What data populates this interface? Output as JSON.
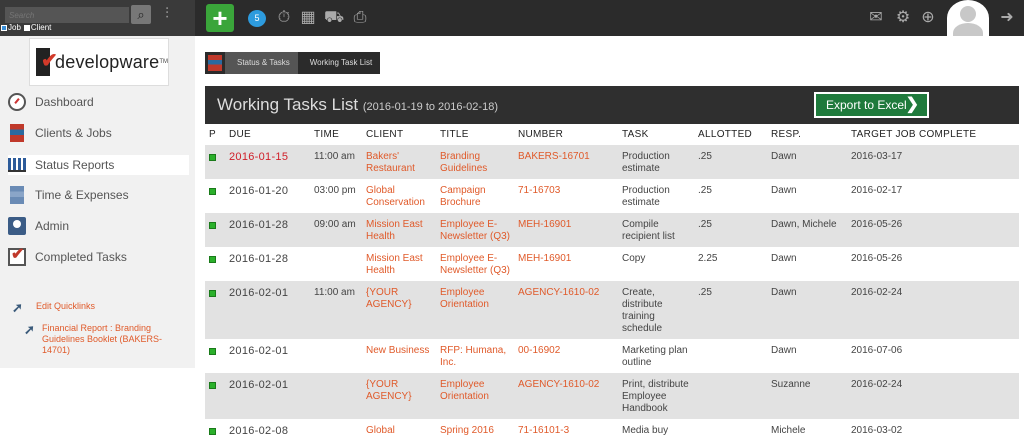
{
  "search": {
    "placeholder": "Search",
    "options": [
      {
        "label": "Job",
        "checked": true
      },
      {
        "label": "Client",
        "checked": false
      }
    ]
  },
  "topbar": {
    "chat_count": "5"
  },
  "logo": {
    "text": "developware",
    "tm": "TM"
  },
  "sidebar": {
    "items": [
      {
        "label": "Dashboard",
        "icon": "dashboard-icon"
      },
      {
        "label": "Clients & Jobs",
        "icon": "clients-jobs-icon"
      },
      {
        "label": "Status Reports",
        "icon": "bar-chart-icon",
        "active": true
      },
      {
        "label": "Time & Expenses",
        "icon": "time-expenses-icon"
      },
      {
        "label": "Admin",
        "icon": "admin-icon"
      },
      {
        "label": "Completed Tasks",
        "icon": "checkbox-icon"
      }
    ],
    "quicklinks": [
      {
        "label": "Edit Quicklinks"
      },
      {
        "label": "Financial Report : Branding Guidelines Booklet (BAKERS-14701)"
      }
    ]
  },
  "breadcrumb": [
    "Status & Tasks",
    "Working Task List"
  ],
  "panel": {
    "title": "Working Tasks List",
    "range": "(2016-01-19 to 2016-02-18)",
    "export_label": "Export to Excel"
  },
  "table": {
    "headers": [
      "P",
      "DUE",
      "TIME",
      "CLIENT",
      "TITLE",
      "NUMBER",
      "TASK",
      "ALLOTTED",
      "RESP.",
      "TARGET JOB COMPLETE"
    ],
    "rows": [
      {
        "due": "2016-01-15",
        "time": "11:00 am",
        "client": "Bakers' Restaurant",
        "title": "Branding Guidelines",
        "number": "BAKERS-16701",
        "task": "Production estimate",
        "allotted": ".25",
        "resp": "Dawn",
        "target": "2016-03-17"
      },
      {
        "due": "2016-01-20",
        "time": "03:00 pm",
        "client": "Global Conservation",
        "title": "Campaign Brochure",
        "number": "71-16703",
        "task": "Production estimate",
        "allotted": ".25",
        "resp": "Dawn",
        "target": "2016-02-17"
      },
      {
        "due": "2016-01-28",
        "time": "09:00 am",
        "client": "Mission East Health",
        "title": "Employee E-Newsletter (Q3)",
        "number": "MEH-16901",
        "task": "Compile recipient list",
        "allotted": ".25",
        "resp": "Dawn, Michele",
        "target": "2016-05-26"
      },
      {
        "due": "2016-01-28",
        "time": "",
        "client": "Mission East Health",
        "title": "Employee E-Newsletter (Q3)",
        "number": "MEH-16901",
        "task": "Copy",
        "allotted": "2.25",
        "resp": "Dawn",
        "target": "2016-05-26"
      },
      {
        "due": "2016-02-01",
        "time": "11:00 am",
        "client": "{YOUR AGENCY}",
        "title": "Employee Orientation",
        "number": "AGENCY-1610-02",
        "task": "Create, distribute training schedule",
        "allotted": ".25",
        "resp": "Dawn",
        "target": "2016-02-24"
      },
      {
        "due": "2016-02-01",
        "time": "",
        "client": "New Business",
        "title": "RFP: Humana, Inc.",
        "number": "00-16902",
        "task": "Marketing plan outline",
        "allotted": "",
        "resp": "Dawn",
        "target": "2016-07-06"
      },
      {
        "due": "2016-02-01",
        "time": "",
        "client": "{YOUR AGENCY}",
        "title": "Employee Orientation",
        "number": "AGENCY-1610-02",
        "task": "Print, distribute Employee Handbook",
        "allotted": "",
        "resp": "Suzanne",
        "target": "2016-02-24"
      },
      {
        "due": "2016-02-08",
        "time": "",
        "client": "Global",
        "title": "Spring 2016",
        "number": "71-16101-3",
        "task": "Media buy",
        "allotted": "",
        "resp": "Michele",
        "target": "2016-03-02"
      }
    ]
  },
  "colors": {
    "accent_link": "#e05a2a",
    "overdue": "#d0202a",
    "priority": "#2bb02b",
    "export": "#1f7a3c",
    "add": "#3aa53a"
  }
}
